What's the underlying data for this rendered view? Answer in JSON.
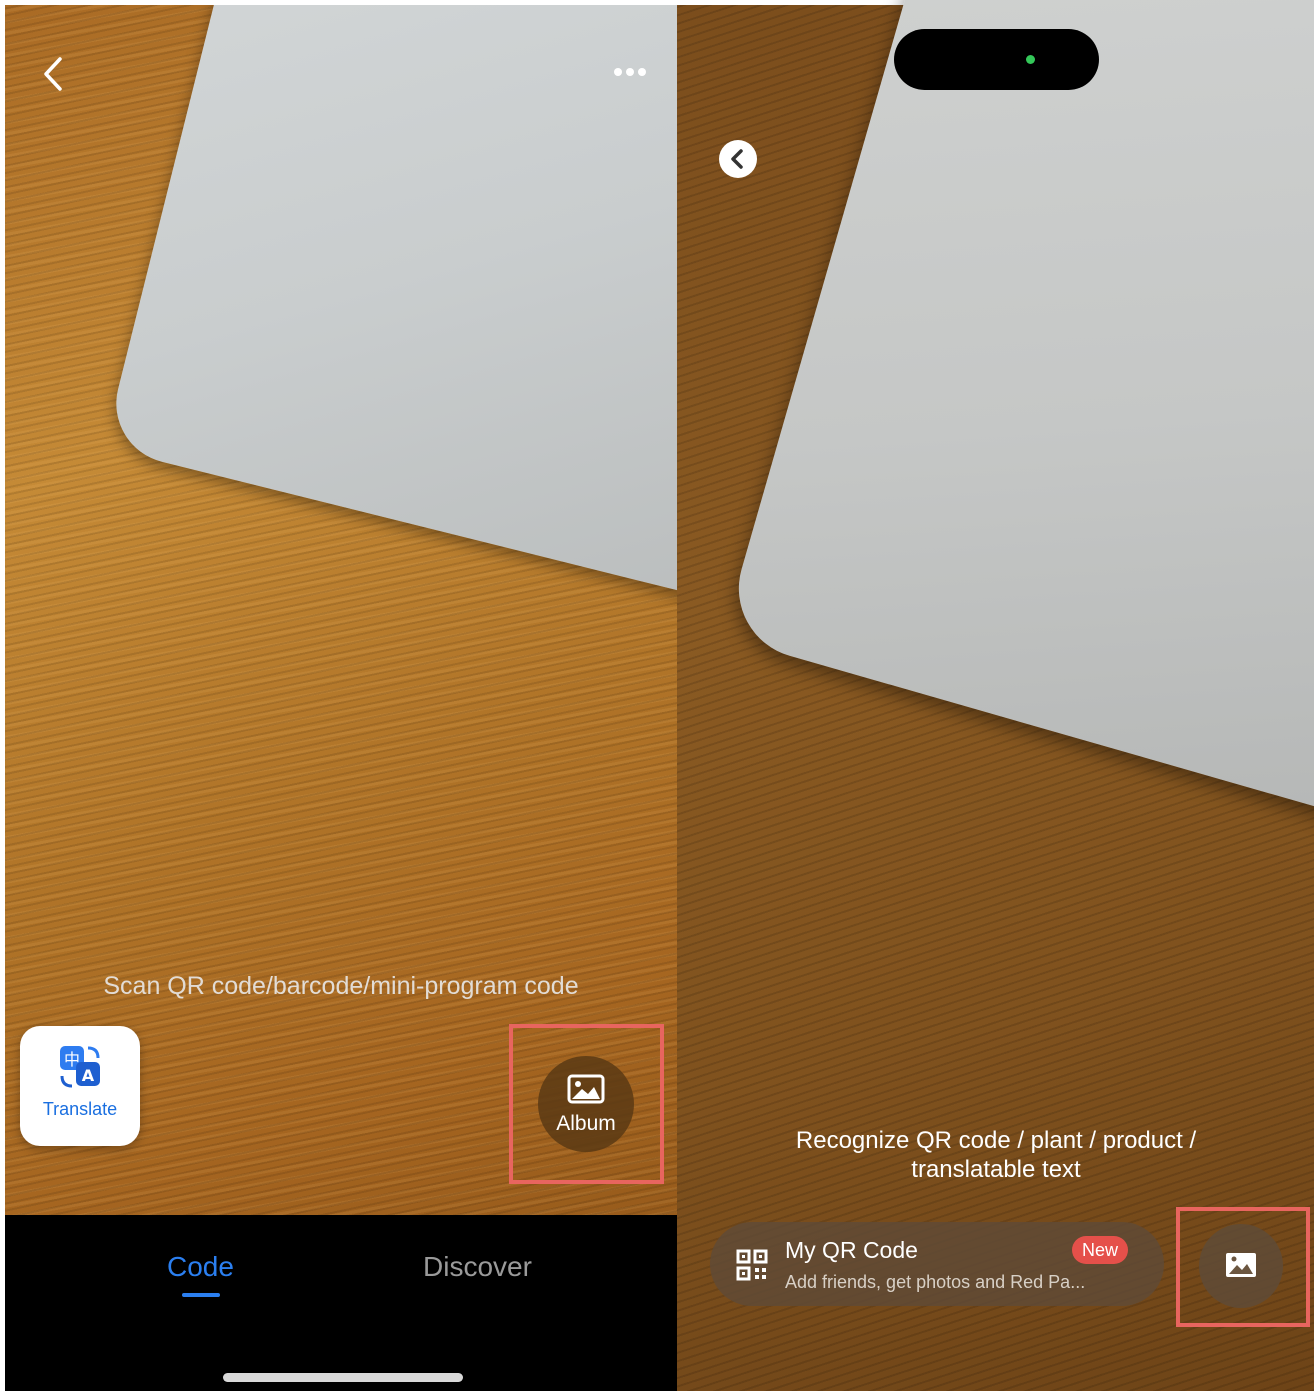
{
  "left_screen": {
    "scan_hint": "Scan QR code/barcode/mini-program code",
    "translate_label": "Translate",
    "album_label": "Album",
    "tabs": [
      {
        "label": "Code",
        "active": true
      },
      {
        "label": "Discover",
        "active": false
      }
    ],
    "icons": [
      "back-icon",
      "more-icon",
      "translate-icon",
      "image-icon"
    ]
  },
  "right_screen": {
    "recognize_hint_line1": "Recognize QR code / plant / product /",
    "recognize_hint_line2": "translatable text",
    "my_qr": {
      "title": "My QR Code",
      "subtitle": "Add friends, get photos and Red Pa...",
      "badge": "New"
    },
    "icons": [
      "back-icon",
      "qr-code-icon",
      "image-icon"
    ]
  },
  "colors": {
    "active_tab": "#2b7ff0",
    "highlight_border": "#e8655f",
    "new_badge": "#e5504a",
    "translate_text": "#1a6fe0"
  }
}
